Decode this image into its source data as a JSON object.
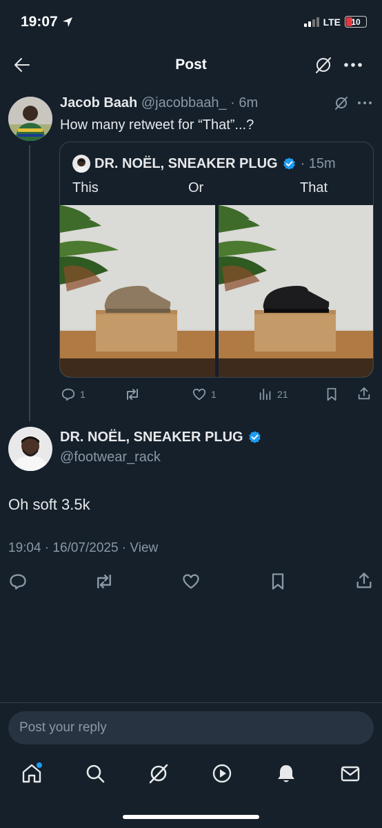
{
  "status_bar": {
    "time": "19:07",
    "network": "LTE",
    "battery": "10"
  },
  "header": {
    "title": "Post"
  },
  "reply_tweet": {
    "display_name": "Jacob Baah",
    "handle": "@jacobbaah_",
    "time": "· 6m",
    "text": "How many retweet for “That”...?"
  },
  "quote": {
    "display_name": "DR. NOËL, SNEAKER PLUG",
    "time": "· 15m",
    "labels": [
      "This",
      "Or",
      "That"
    ]
  },
  "reply_actions": {
    "replies": "1",
    "reposts": "",
    "likes": "1",
    "views": "21"
  },
  "main_tweet": {
    "display_name": "DR. NOËL, SNEAKER PLUG",
    "handle": "@footwear_rack",
    "text": "Oh soft 3.5k",
    "timestamp": "19:04 · 16/07/2025 ·",
    "view_label": "View"
  },
  "reply_input": {
    "placeholder": "Post your reply"
  },
  "colors": {
    "background": "#15202b",
    "verified": "#1d9bf0",
    "notification_dot": "#1d9bf0"
  }
}
